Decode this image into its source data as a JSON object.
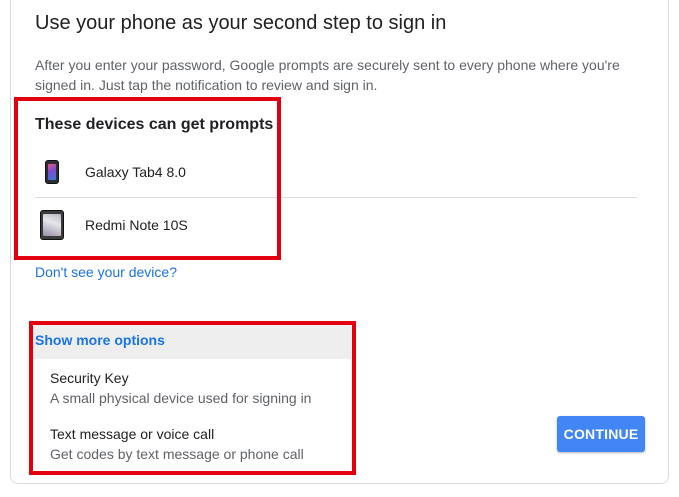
{
  "header": {
    "title": "Use your phone as your second step to sign in",
    "description": "After you enter your password, Google prompts are securely sent to every phone where you're signed in. Just tap the notification to review and sign in."
  },
  "devices": {
    "heading": "These devices can get prompts",
    "items": [
      {
        "label": "Galaxy Tab4 8.0",
        "icon": "phone-icon"
      },
      {
        "label": "Redmi Note 10S",
        "icon": "phone-icon"
      }
    ],
    "help_link": "Don't see your device?"
  },
  "more_options": {
    "header": "Show more options",
    "items": [
      {
        "title": "Security Key",
        "subtitle": "A small physical device used for signing in"
      },
      {
        "title": "Text message or voice call",
        "subtitle": "Get codes by text message or phone call"
      }
    ]
  },
  "actions": {
    "continue_label": "CONTINUE"
  },
  "colors": {
    "accent": "#1a73e8",
    "button": "#4285f4",
    "highlight": "#e2000f"
  }
}
